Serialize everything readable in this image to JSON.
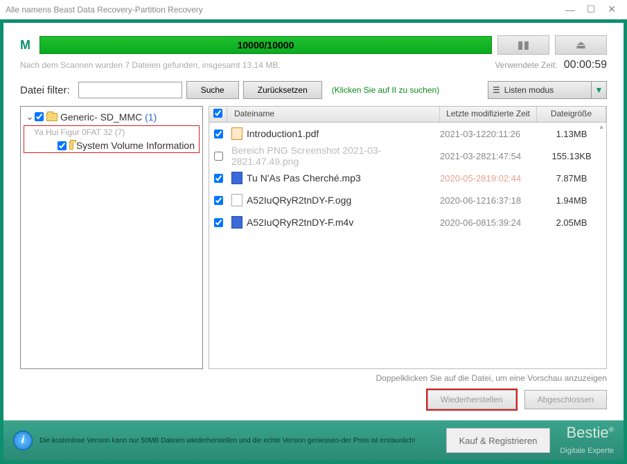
{
  "window": {
    "title": "Alle namens Beast Data Recovery-Partition Recovery"
  },
  "scan": {
    "drive_letter": "M",
    "progress_text": "10000/10000",
    "status_text": "Nach dem Scannen wurden 7 Dateien gefunden, insgesamt 13,14 MB.",
    "elapsed_label": "Verwendete Zeit:",
    "elapsed_value": "00:00:59"
  },
  "filter": {
    "label": "Datei filter:",
    "input_value": "",
    "placeholder": "",
    "search_btn": "Suche",
    "reset_btn": "Zurücksetzen",
    "hint": "(Klicken Sie auf II zu suchen)"
  },
  "viewmode": {
    "label": "Listen modus"
  },
  "tree": {
    "root": {
      "label": "Generic- SD_MMC",
      "count": "(1)"
    },
    "group": {
      "label": "Ya Hui Figur 0FAT 32 (7)"
    },
    "child": {
      "label": "System Volume Information"
    }
  },
  "columns": {
    "name": "Dateiname",
    "date": "Letzte modifizierte Zeit",
    "size": "Dateigröße"
  },
  "files": [
    {
      "name": "Introduction1.pdf",
      "date": "2021-03-1220:11:26",
      "size": "1.13MB",
      "icon": "pdf",
      "checked": true
    },
    {
      "name": "Bereich PNG Screenshot 2021-03-2821.47.49.png",
      "date": "2021-03-2821:47:54",
      "size": "155.13KB",
      "icon": "",
      "checked": false,
      "muted": true
    },
    {
      "name": "Tu N'As Pas Cherché.mp3",
      "date": "2020-05-2819:02:44",
      "size": "7.87MB",
      "icon": "mp3",
      "checked": true,
      "muted_date": true
    },
    {
      "name": "A52IuQRyR2tnDY-F.ogg",
      "date": "2020-06-1216:37:18",
      "size": "1.94MB",
      "icon": "txt",
      "checked": true
    },
    {
      "name": "A52IuQRyR2tnDY-F.m4v",
      "date": "2020-06-0815:39:24",
      "size": "2.05MB",
      "icon": "m4v",
      "checked": true
    }
  ],
  "hints": {
    "double_click": "Doppelklicken Sie auf die Datei, um eine Vorschau anzuzeigen"
  },
  "buttons": {
    "recover": "Wiederherstellen",
    "close": "Abgeschlossen"
  },
  "footer": {
    "trial_text": "Die kostenlose Version kann nur 50MB Dateien wiederherstellen und die echte Version geniessen-der Preis ist erstaunlich!",
    "buy_btn": "Kauf & Registrieren",
    "brand": "Bestie",
    "brand_sub": "Digitale Experte"
  }
}
